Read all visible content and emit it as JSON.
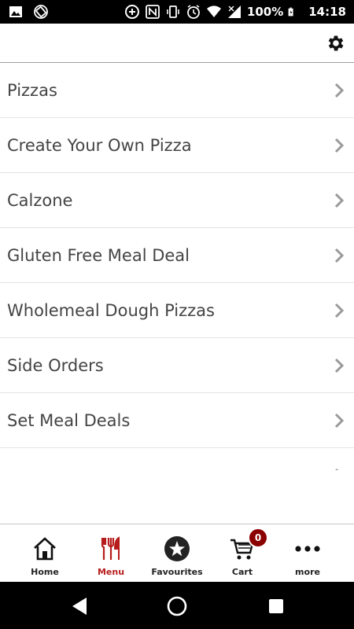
{
  "status_bar": {
    "battery": "100%",
    "time": "14:18",
    "left_icons": [
      "image-icon",
      "rotation-lock-icon"
    ],
    "right_icons": [
      "data-saver-icon",
      "nfc-icon",
      "vibrate-icon",
      "alarm-icon",
      "wifi-icon",
      "signal-icon",
      "battery-charging-icon"
    ]
  },
  "top_bar": {
    "settings_icon": "gear-icon"
  },
  "menu": {
    "items": [
      {
        "label": "Pizzas"
      },
      {
        "label": "Create Your Own Pizza"
      },
      {
        "label": "Calzone"
      },
      {
        "label": "Gluten Free Meal Deal"
      },
      {
        "label": "Wholemeal Dough Pizzas"
      },
      {
        "label": "Side Orders"
      },
      {
        "label": "Set Meal Deals"
      }
    ]
  },
  "bottom_nav": {
    "items": [
      {
        "label": "Home",
        "icon": "home-icon"
      },
      {
        "label": "Menu",
        "icon": "cutlery-icon"
      },
      {
        "label": "Favourites",
        "icon": "star-icon"
      },
      {
        "label": "Cart",
        "icon": "cart-icon"
      },
      {
        "label": "more",
        "icon": "more-icon"
      }
    ],
    "active": "Menu",
    "cart_count": "0"
  },
  "colors": {
    "accent": "#b71c1c",
    "badge": "#8b0000",
    "text": "#444444",
    "chevron": "#9a9a9a"
  }
}
